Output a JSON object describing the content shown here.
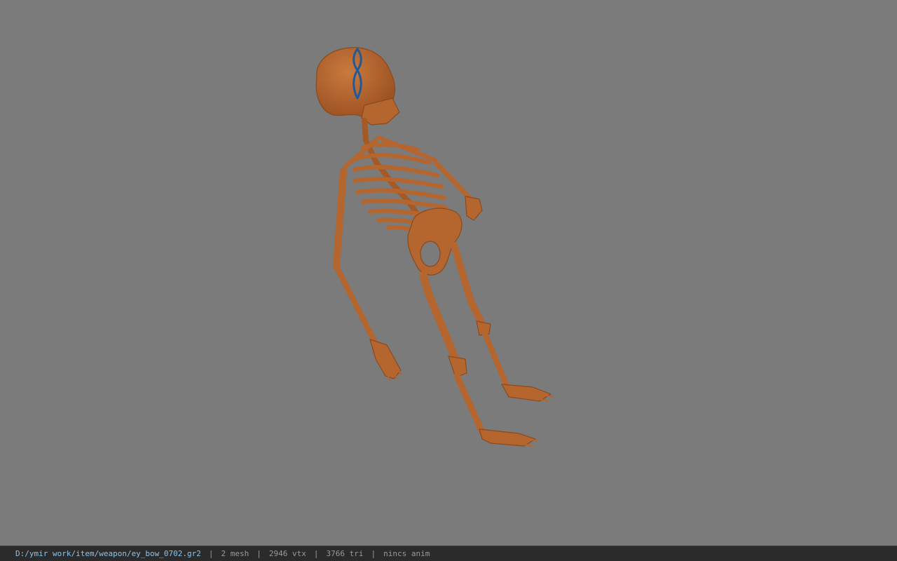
{
  "viewport": {
    "background_color": "#7b7b7b",
    "model_color": "#b5652e",
    "gizmo_color": "#1f5a9a",
    "model": "skeleton"
  },
  "statusbar": {
    "file_path": "D:/ymir work/item/weapon/ey_bow_0702.gr2",
    "separator": "|",
    "mesh_count": "2 mesh",
    "vertex_count": "2946 vtx",
    "triangle_count": "3766 tri",
    "anim_status": "nincs anim"
  }
}
